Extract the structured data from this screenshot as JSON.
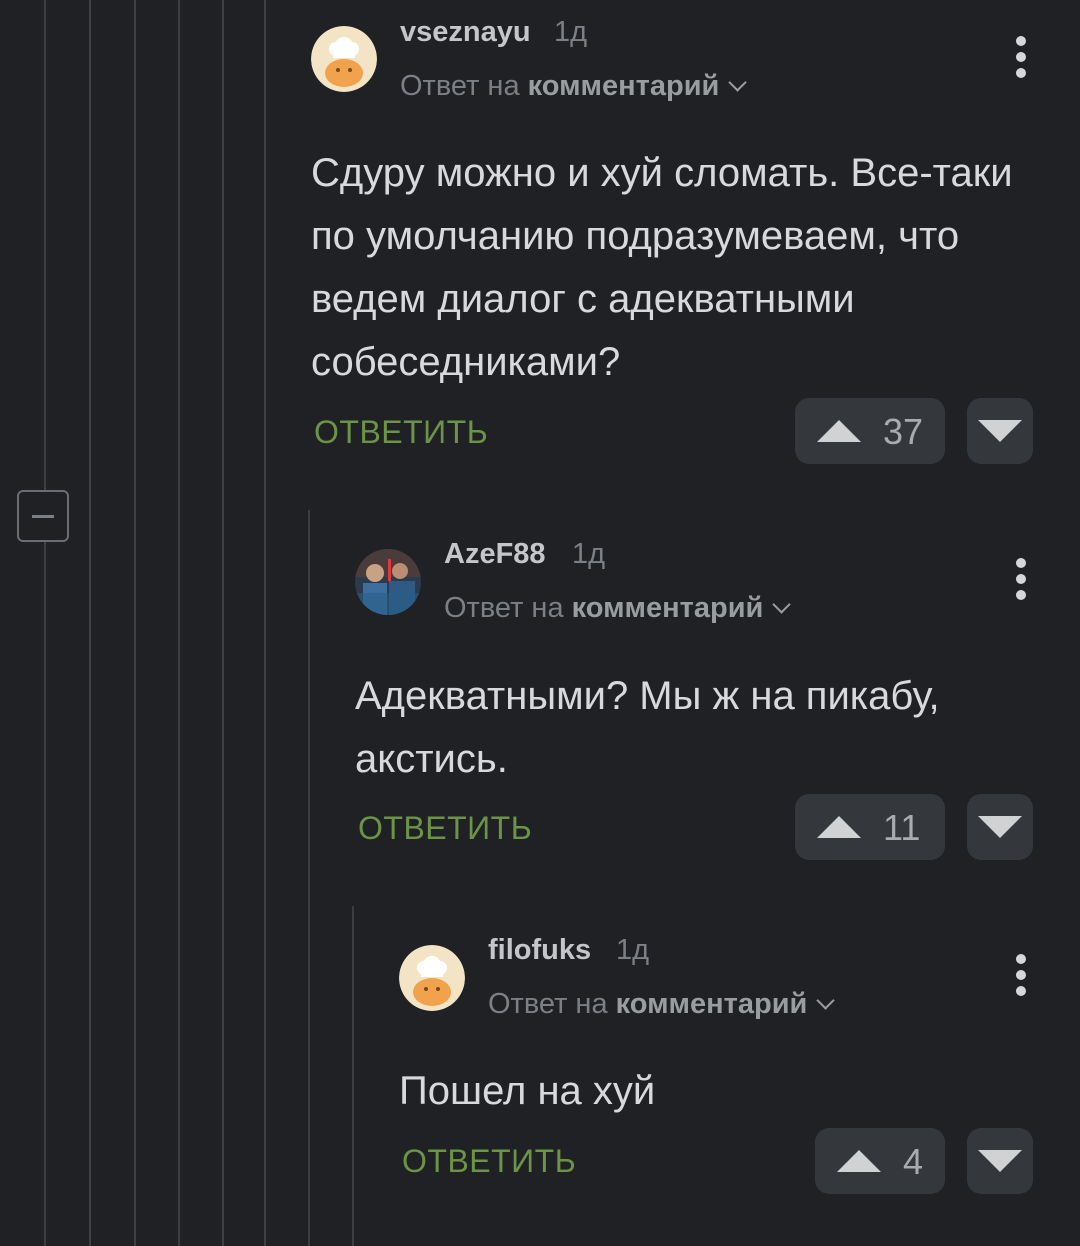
{
  "comments": [
    {
      "username": "vseznayu",
      "time": "1д",
      "reply_prefix": "Ответ на",
      "reply_target": "комментарий",
      "text": "Сдуру можно и хуй сломать. Все-таки по умолчанию подразумеваем, что ведем диалог с адекватными собеседниками?",
      "reply_label": "ОТВЕТИТЬ",
      "rating": "37",
      "avatar_icon": "chef-hat-avatar-icon"
    },
    {
      "username": "AzeF88",
      "time": "1д",
      "reply_prefix": "Ответ на",
      "reply_target": "комментарий",
      "text": "Адекватными? Мы ж на пикабу, акстись.",
      "reply_label": "ОТВЕТИТЬ",
      "rating": "11",
      "avatar_icon": "photo-avatar-icon"
    },
    {
      "username": "filofuks",
      "time": "1д",
      "reply_prefix": "Ответ на",
      "reply_target": "комментарий",
      "text": "Пошел на хуй",
      "reply_label": "ОТВЕТИТЬ",
      "rating": "4",
      "avatar_icon": "chef-hat-avatar-icon"
    }
  ],
  "colors": {
    "background": "#1f2124",
    "accent_reply": "#6c9446",
    "vote_box": "#34373b"
  }
}
